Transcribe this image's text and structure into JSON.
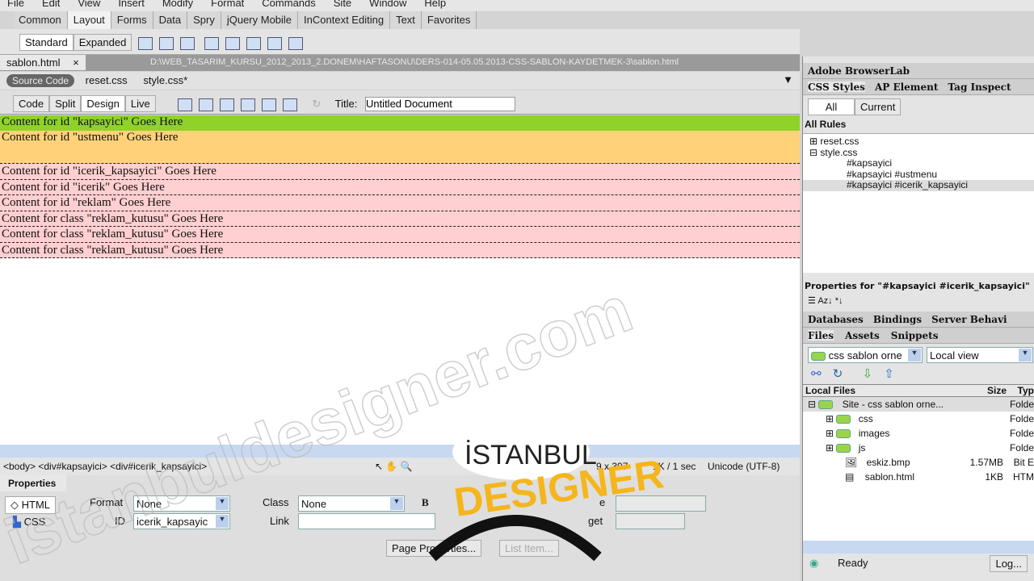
{
  "menu": [
    "File",
    "Edit",
    "View",
    "Insert",
    "Modify",
    "Format",
    "Commands",
    "Site",
    "Window",
    "Help"
  ],
  "insert_tabs": [
    "Common",
    "Layout",
    "Forms",
    "Data",
    "Spry",
    "jQuery Mobile",
    "InContext Editing",
    "Text",
    "Favorites"
  ],
  "insert_active": "Layout",
  "layout_modes": {
    "standard": "Standard",
    "expanded": "Expanded"
  },
  "doc": {
    "tab": "sablon.html",
    "close": "×",
    "path": "D:\\WEB_TASARIM_KURSU_2012_2013_2.DONEM\\HAFTASONU\\DERS-014-05.05.2013-CSS-SABLON-KAYDETMEK-3\\sablon.html"
  },
  "related": {
    "source": "Source Code",
    "files": [
      "reset.css",
      "style.css*"
    ]
  },
  "views": [
    "Code",
    "Split",
    "Design",
    "Live"
  ],
  "title_label": "Title:",
  "title_value": "Untitled Document",
  "design": {
    "kapsayici": "Content for id \"kapsayici\" Goes Here",
    "ustmenu": "Content for id \"ustmenu\" Goes Here",
    "rows": [
      "Content for id \"icerik_kapsayici\" Goes Here",
      "Content for id \"icerik\" Goes Here",
      "Content for id \"reklam\" Goes Here",
      "Content for class \"reklam_kutusu\" Goes Here",
      "Content for class \"reklam_kutusu\" Goes Here",
      "Content for class \"reklam_kutusu\" Goes Here"
    ],
    "colors": {
      "kapsayici": "#8fd22a",
      "ustmenu": "#ffd27a",
      "rows": "#ffcfd1"
    }
  },
  "status": {
    "tag": "<body> <div#kapsayici> <div#icerik_kapsayici>",
    "size": "9 x 397",
    "dl": "1K / 1 sec",
    "enc": "Unicode (UTF-8)"
  },
  "properties": {
    "title": "Properties",
    "html": "HTML",
    "css": "CSS",
    "format_label": "Format",
    "format": "None",
    "id_label": "ID",
    "id": "icerik_kapsayic",
    "class_label": "Class",
    "class": "None",
    "link_label": "Link",
    "bold": "B",
    "title_frag": "e",
    "target_frag": "get",
    "page_props": "Page Properties...",
    "list_item": "List Item..."
  },
  "right": {
    "browserlab": "Adobe BrowserLab",
    "css_tabs": [
      "CSS Styles",
      "AP Element",
      "Tag Inspect"
    ],
    "all": "All",
    "current": "Current",
    "all_rules": "All Rules",
    "rules": [
      "reset.css",
      "style.css",
      "#kapsayici",
      "#kapsayici #ustmenu",
      "#kapsayici #icerik_kapsayici"
    ],
    "props_for": "Properties for \"#kapsayici #icerik_kapsayici\"",
    "db_tabs": [
      "Databases",
      "Bindings",
      "Server Behavi"
    ],
    "file_tabs": [
      "Files",
      "Assets",
      "Snippets"
    ],
    "site": "css sablon orne",
    "view": "Local view",
    "cols": {
      "name": "Local Files",
      "size": "Size",
      "type": "Typ"
    },
    "files": [
      {
        "name": "Site - css sablon orne...",
        "size": "",
        "type": "Folde"
      },
      {
        "name": "css",
        "size": "",
        "type": "Folde"
      },
      {
        "name": "images",
        "size": "",
        "type": "Folde"
      },
      {
        "name": "js",
        "size": "",
        "type": "Folde"
      },
      {
        "name": "eskiz.bmp",
        "size": "1.57MB",
        "type": "Bit E"
      },
      {
        "name": "sablon.html",
        "size": "1KB",
        "type": "HTM"
      }
    ],
    "ready": "Ready",
    "log": "Log..."
  },
  "watermark": {
    "text": "istanbuldesigner.com",
    "logo_top": "İSTANBUL",
    "logo_bottom": "DESIGNER"
  }
}
